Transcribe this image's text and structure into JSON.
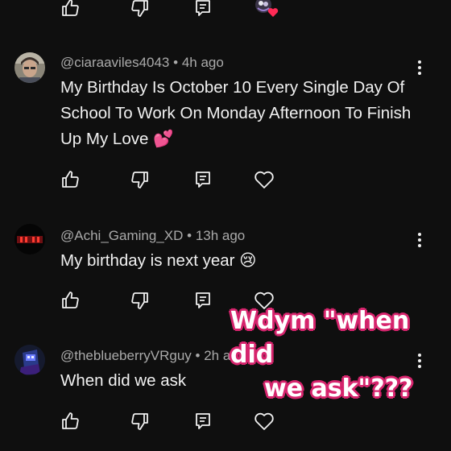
{
  "top_action_row": {
    "like_icon": "thumb-up-outline",
    "dislike_icon": "thumb-down-outline",
    "reply_icon": "comment-outline",
    "creator_heart": "creator-heart-avatar"
  },
  "comments": [
    {
      "handle": "@ciaraaviles4043",
      "time": "4h ago",
      "text": "My Birthday Is October 10 Every Single Day Of School To Work On Monday Afternoon To Finish Up My Love 💕"
    },
    {
      "handle": "@Achi_Gaming_XD",
      "time": "13h ago",
      "text": "My birthday is next year 😢"
    },
    {
      "handle": "@theblueberryVRguy",
      "time": "2h ago",
      "text": "When did we ask"
    }
  ],
  "separator": "•",
  "overlay_caption": {
    "line1": "Wdym \"when did",
    "line2": "we ask\"???"
  },
  "colors": {
    "background": "#0f0f0f",
    "text": "#f1f1f1",
    "meta": "#aaaaaa",
    "overlay_stroke": "#d6246d",
    "heart": "#ff2a55"
  }
}
